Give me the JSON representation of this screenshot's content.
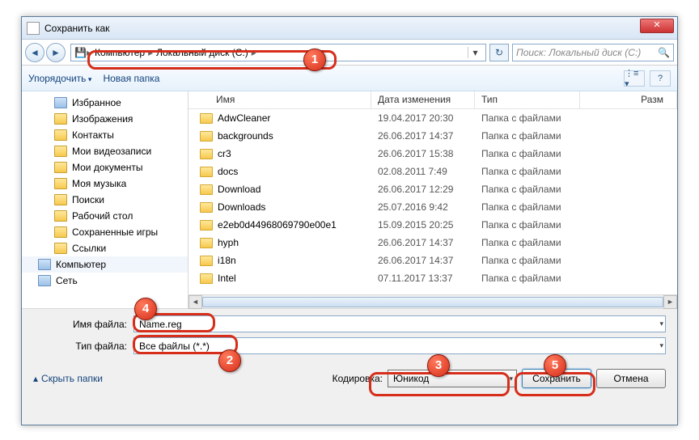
{
  "title": "Сохранить как",
  "close_x": "✕",
  "breadcrumb": {
    "c0": "Компьютер",
    "c1": "Локальный диск (C:)"
  },
  "search_placeholder": "Поиск: Локальный диск (C:)",
  "toolbar": {
    "organize": "Упорядочить",
    "newfolder": "Новая папка"
  },
  "sidebar": [
    {
      "label": "Избранное",
      "icon": "sp"
    },
    {
      "label": "Изображения"
    },
    {
      "label": "Контакты"
    },
    {
      "label": "Мои видеозаписи"
    },
    {
      "label": "Мои документы"
    },
    {
      "label": "Моя музыка"
    },
    {
      "label": "Поиски"
    },
    {
      "label": "Рабочий стол"
    },
    {
      "label": "Сохраненные игры"
    },
    {
      "label": "Ссылки"
    },
    {
      "label": "Компьютер",
      "icon": "sp",
      "l1": true,
      "sel": true
    },
    {
      "label": "Сеть",
      "icon": "sp",
      "l1": true
    }
  ],
  "columns": {
    "name": "Имя",
    "date": "Дата изменения",
    "type": "Тип",
    "size": "Разм"
  },
  "files": [
    {
      "name": "AdwCleaner",
      "date": "19.04.2017 20:30",
      "type": "Папка с файлами"
    },
    {
      "name": "backgrounds",
      "date": "26.06.2017 14:37",
      "type": "Папка с файлами"
    },
    {
      "name": "cr3",
      "date": "26.06.2017 15:38",
      "type": "Папка с файлами"
    },
    {
      "name": "docs",
      "date": "02.08.2011 7:49",
      "type": "Папка с файлами"
    },
    {
      "name": "Download",
      "date": "26.06.2017 12:29",
      "type": "Папка с файлами"
    },
    {
      "name": "Downloads",
      "date": "25.07.2016 9:42",
      "type": "Папка с файлами"
    },
    {
      "name": "e2eb0d44968069790e00e1",
      "date": "15.09.2015 20:25",
      "type": "Папка с файлами"
    },
    {
      "name": "hyph",
      "date": "26.06.2017 14:37",
      "type": "Папка с файлами"
    },
    {
      "name": "i18n",
      "date": "26.06.2017 14:37",
      "type": "Папка с файлами"
    },
    {
      "name": "Intel",
      "date": "07.11.2017 13:37",
      "type": "Папка с файлами"
    }
  ],
  "filename_label": "Имя файла:",
  "filename_value": "Name.reg",
  "filetype_label": "Тип файла:",
  "filetype_value": "Все файлы  (*.*)",
  "hide_folders": "Скрыть папки",
  "encoding_label": "Кодировка:",
  "encoding_value": "Юникод",
  "save": "Сохранить",
  "cancel": "Отмена",
  "badges": {
    "1": "1",
    "2": "2",
    "3": "3",
    "4": "4",
    "5": "5"
  }
}
